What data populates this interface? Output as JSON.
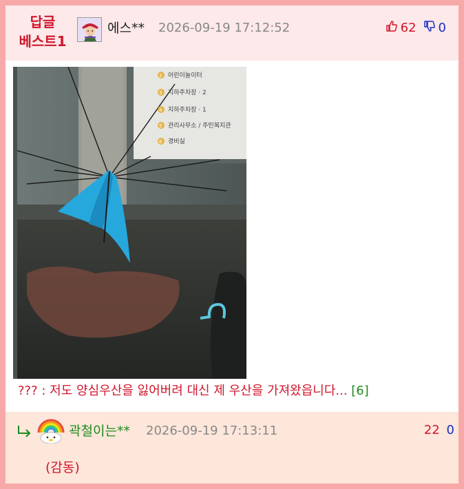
{
  "post": {
    "badge_line1": "답글",
    "badge_line2": "베스트1",
    "username": "에스**",
    "datetime": "2026-09-19 17:12:52",
    "upvotes": "62",
    "downvotes": "0",
    "comment_prefix": "??? : ",
    "comment_body": "저도 양심우산을 잃어버려 대신 제 우산을 가져왔읍니다...",
    "reply_count": "[6]",
    "photo_sign_lines": [
      "어린이놀이터",
      "지하주차장 · 2",
      "지하주차장 · 1",
      "관리사무소 / 주민복지관",
      "경비실"
    ],
    "photo_sign_numbers": [
      "2",
      "3",
      "4",
      "5",
      "6"
    ]
  },
  "reply": {
    "username": "곽철이는**",
    "datetime": "2026-09-19 17:13:11",
    "upvotes": "22",
    "downvotes": "0",
    "text": "(감동)"
  },
  "icons": {
    "upvote": "thumbs-up-icon",
    "downvote": "thumbs-down-icon",
    "reply": "reply-arrow-icon"
  },
  "colors": {
    "accent_red": "#d0162c",
    "accent_blue": "#1a2fc4",
    "accent_green": "#1d8a1d",
    "frame_pink": "#f7a9a9"
  }
}
